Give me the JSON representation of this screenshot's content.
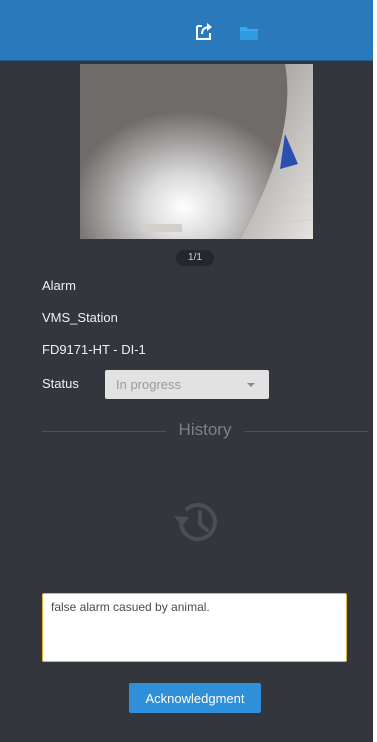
{
  "toolbar": {
    "icons": [
      "export-icon",
      "folder-icon"
    ],
    "color": "#2a79bb"
  },
  "snapshot": {
    "pager": "1/1"
  },
  "event": {
    "type": "Alarm",
    "source": "VMS_Station",
    "device": "FD9171-HT - DI-1"
  },
  "status": {
    "label": "Status",
    "selected": "In progress"
  },
  "history": {
    "title": "History",
    "icon": "history-icon"
  },
  "note": {
    "value": "false alarm casued by animal."
  },
  "actions": {
    "acknowledge_label": "Acknowledgment",
    "accent": "#2f8fd8"
  }
}
